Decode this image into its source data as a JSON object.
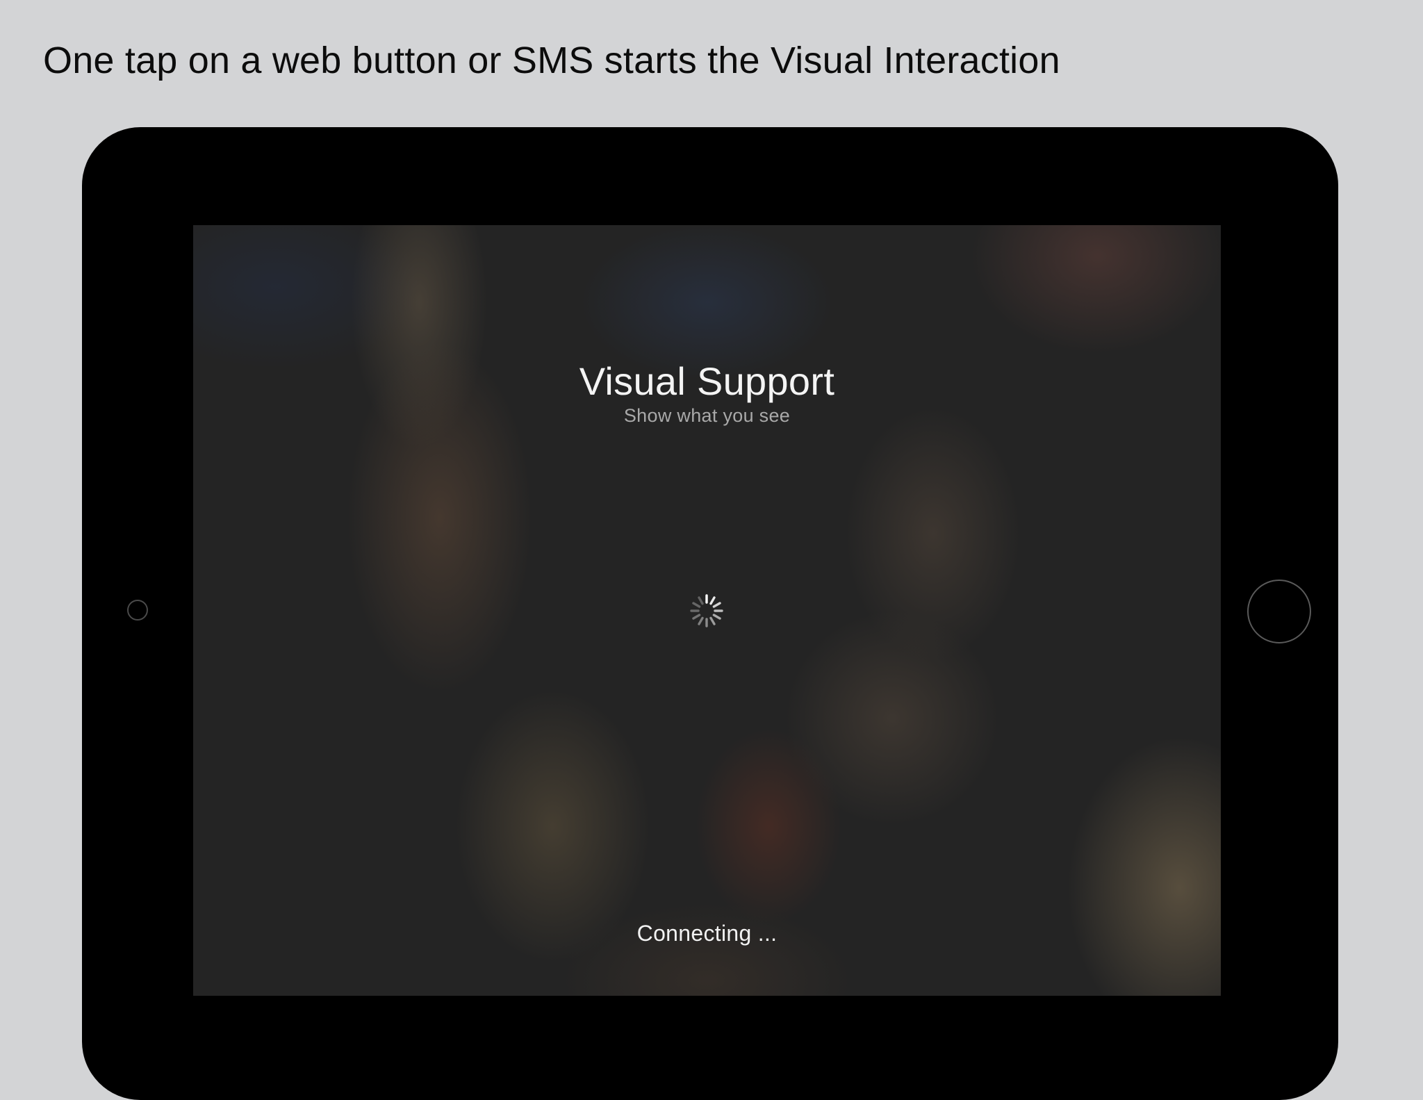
{
  "caption": "One tap on a web button or SMS starts the Visual Interaction",
  "app": {
    "title": "Visual Support",
    "subtitle": "Show what you see",
    "status": "Connecting ..."
  },
  "icons": {
    "spinner": "loading-spinner-icon",
    "camera": "front-camera",
    "home": "home-button"
  },
  "colors": {
    "background": "#d3d4d6",
    "device": "#000000",
    "screen": "#242424"
  }
}
